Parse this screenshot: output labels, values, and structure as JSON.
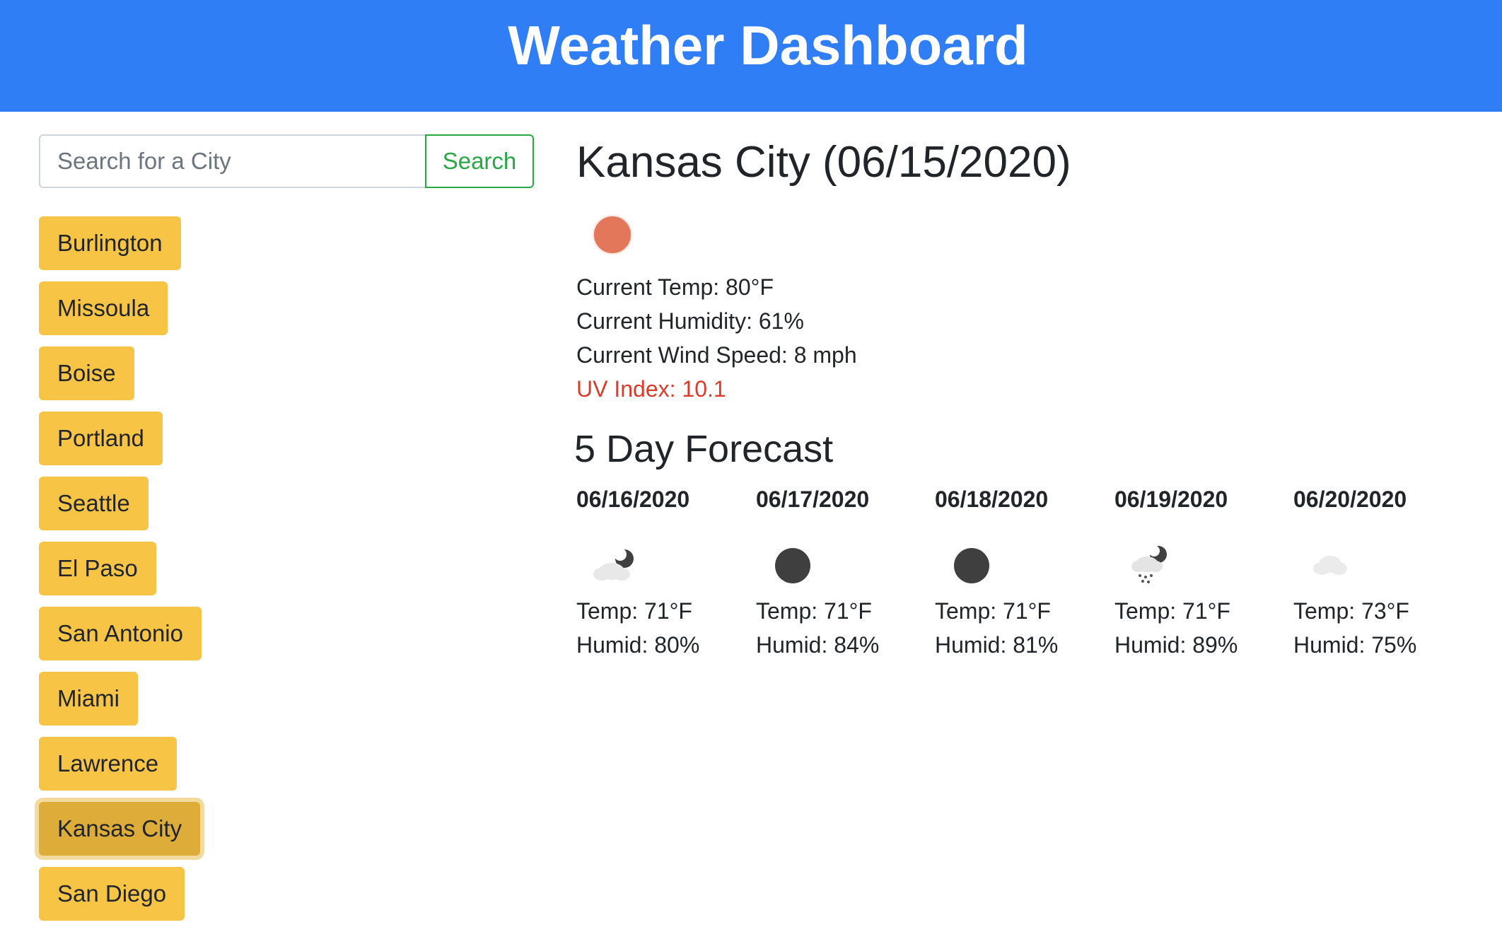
{
  "header": {
    "title": "Weather Dashboard",
    "bg_color": "#2f7ef5"
  },
  "search": {
    "placeholder": "Search for a City",
    "value": "",
    "button_label": "Search"
  },
  "cities": [
    {
      "label": "Burlington",
      "active": false
    },
    {
      "label": "Missoula",
      "active": false
    },
    {
      "label": "Boise",
      "active": false
    },
    {
      "label": "Portland",
      "active": false
    },
    {
      "label": "Seattle",
      "active": false
    },
    {
      "label": "El Paso",
      "active": false
    },
    {
      "label": "San Antonio",
      "active": false
    },
    {
      "label": "Miami",
      "active": false
    },
    {
      "label": "Lawrence",
      "active": false
    },
    {
      "label": "Kansas City",
      "active": true
    },
    {
      "label": "San Diego",
      "active": false
    }
  ],
  "current": {
    "heading": "Kansas City (06/15/2020)",
    "icon": "clear-sun-icon",
    "temp": "Current Temp: 80°F",
    "humidity": "Current Humidity: 61%",
    "wind": "Current Wind Speed: 8 mph",
    "uv": "UV Index: 10.1",
    "uv_color": "#dc3a2a"
  },
  "forecast": {
    "heading": "5 Day Forecast",
    "days": [
      {
        "date": "06/16/2020",
        "icon": "partly-cloudy-night-icon",
        "temp": "Temp: 71°F",
        "humid": "Humid: 80%"
      },
      {
        "date": "06/17/2020",
        "icon": "clear-night-icon",
        "temp": "Temp: 71°F",
        "humid": "Humid: 84%"
      },
      {
        "date": "06/18/2020",
        "icon": "clear-night-icon",
        "temp": "Temp: 71°F",
        "humid": "Humid: 81%"
      },
      {
        "date": "06/19/2020",
        "icon": "rain-night-icon",
        "temp": "Temp: 71°F",
        "humid": "Humid: 89%"
      },
      {
        "date": "06/20/2020",
        "icon": "cloud-icon",
        "temp": "Temp: 73°F",
        "humid": "Humid: 75%"
      }
    ]
  }
}
